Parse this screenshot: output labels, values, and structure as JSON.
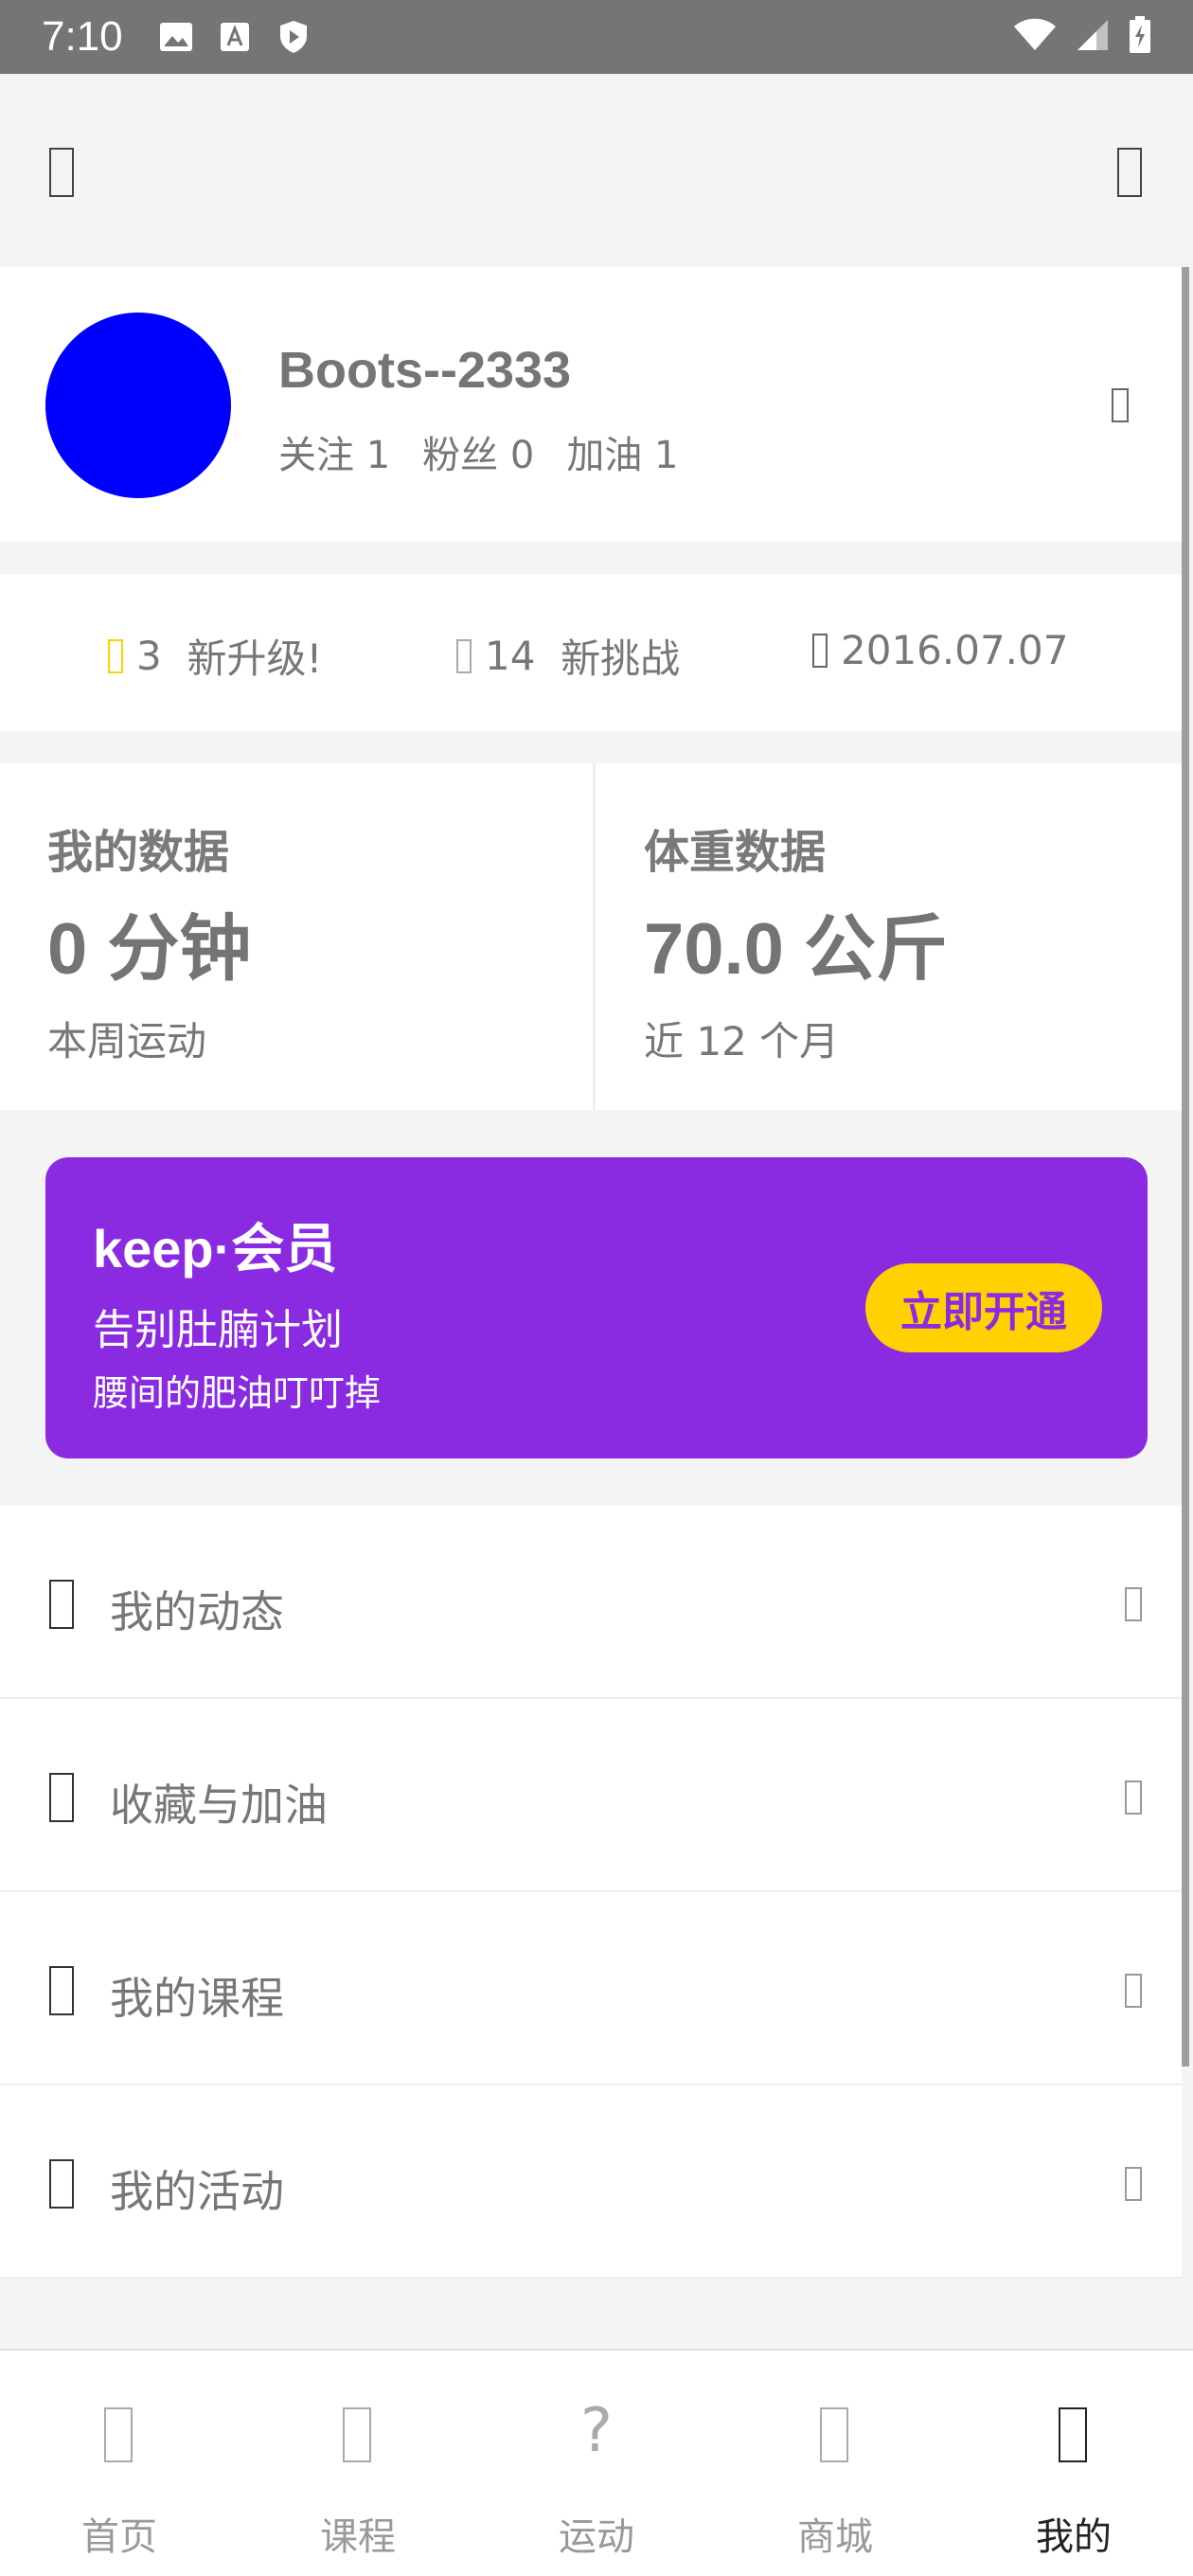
{
  "status_bar": {
    "time": "7:10",
    "left_icons": [
      "image-icon",
      "a-icon",
      "shield-play-icon"
    ],
    "right_icons": [
      "wifi-icon",
      "signal-icon",
      "battery-icon"
    ]
  },
  "profile": {
    "username": "Boots--2333",
    "follow": "关注 1",
    "fans": "粉丝 0",
    "cheer": "加油 1",
    "avatar_color": "#0000ff"
  },
  "stats": [
    {
      "value": "3",
      "text": "新升级!",
      "icon_color": "#ffd100"
    },
    {
      "value": "14",
      "text": "新挑战",
      "icon_color": "#aaaaaa"
    },
    {
      "value": "",
      "text": "2016.07.07",
      "icon_color": "#666666"
    }
  ],
  "data_cards": {
    "my_data": {
      "title": "我的数据",
      "value": "0 分钟",
      "sub": "本周运动"
    },
    "weight": {
      "title": "体重数据",
      "value": "70.0 公斤",
      "sub": "近 12 个月"
    }
  },
  "membership": {
    "brand": "keep·会员",
    "title": "告别肚腩计划",
    "subtitle": "腰间的肥油叮叮掉",
    "button": "立即开通",
    "bg_color": "#8a2be2",
    "button_color": "#ffd100"
  },
  "menu": [
    {
      "label": "我的动态"
    },
    {
      "label": "收藏与加油"
    },
    {
      "label": "我的课程"
    },
    {
      "label": "我的活动"
    }
  ],
  "tabs": [
    {
      "label": "首页",
      "active": false
    },
    {
      "label": "课程",
      "active": false
    },
    {
      "label": "运动",
      "active": false,
      "glyph": "?"
    },
    {
      "label": "商城",
      "active": false
    },
    {
      "label": "我的",
      "active": true
    }
  ]
}
